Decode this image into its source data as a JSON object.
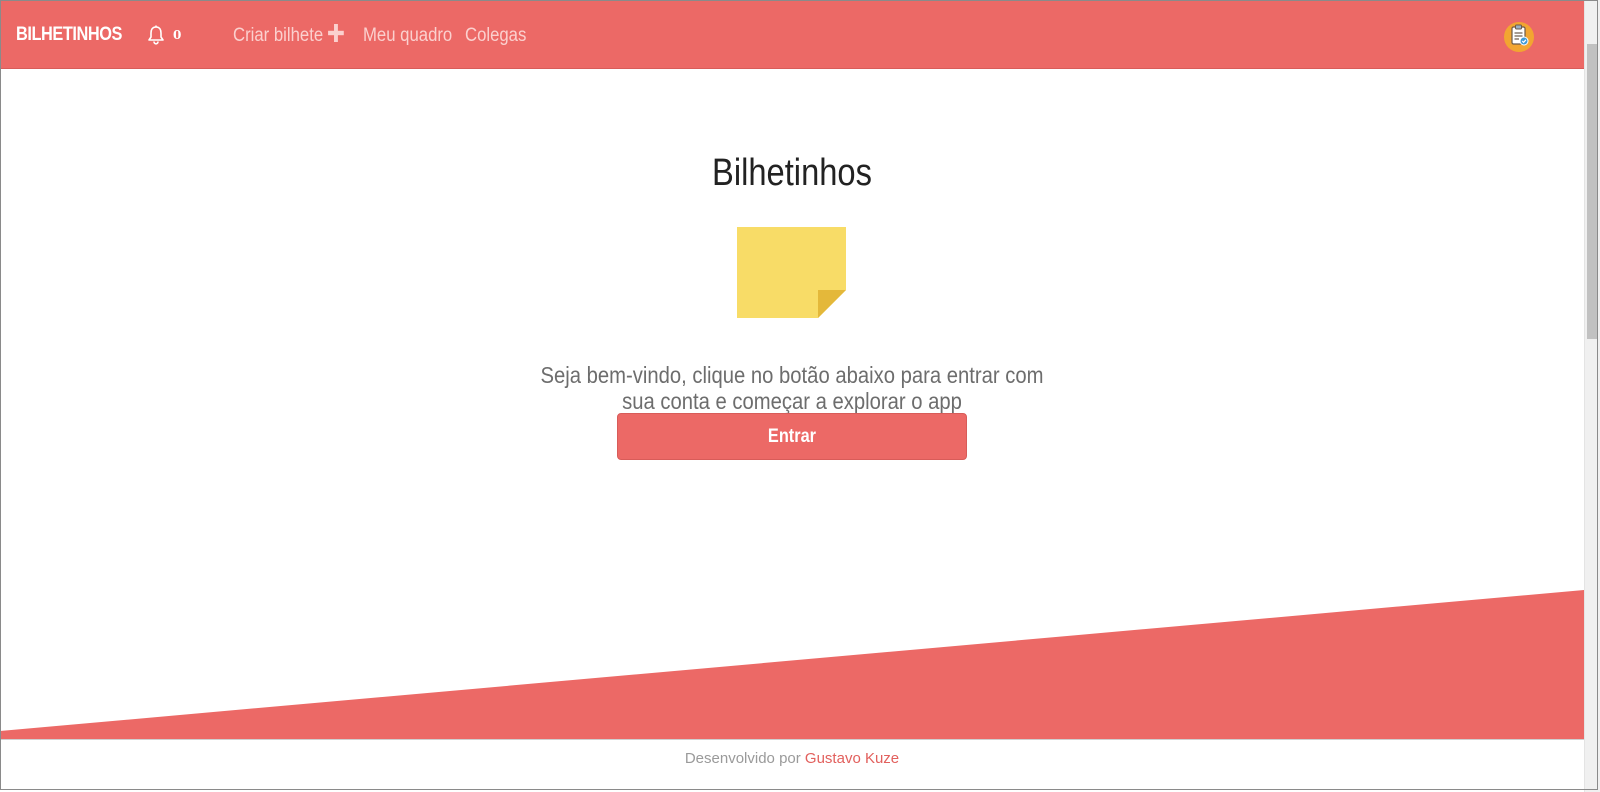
{
  "navbar": {
    "brand": "BILHETINHOS",
    "notification_count": "0",
    "links": [
      {
        "label": "Criar bilhete"
      },
      {
        "label": "Meu quadro"
      },
      {
        "label": "Colegas"
      }
    ],
    "icons": {
      "notifications": "bell-icon",
      "create": "plus-icon",
      "profile": "clipboard-avatar-icon"
    }
  },
  "main": {
    "title": "Bilhetinhos",
    "welcome_text": "Seja bem-vindo, clique no botão abaixo para entrar com sua conta e começar a explorar o app",
    "enter_button": "Entrar",
    "illustration": "sticky-note-icon"
  },
  "footer": {
    "prefix": "Desenvolvido por",
    "author": "Gustavo Kuze"
  },
  "colors": {
    "primary": "#ec6966",
    "nav_link": "#fbd0ce",
    "note": "#f8dc67",
    "note_fold": "#e4b83a",
    "avatar": "#f2a531",
    "footer_link": "#e2605d"
  }
}
